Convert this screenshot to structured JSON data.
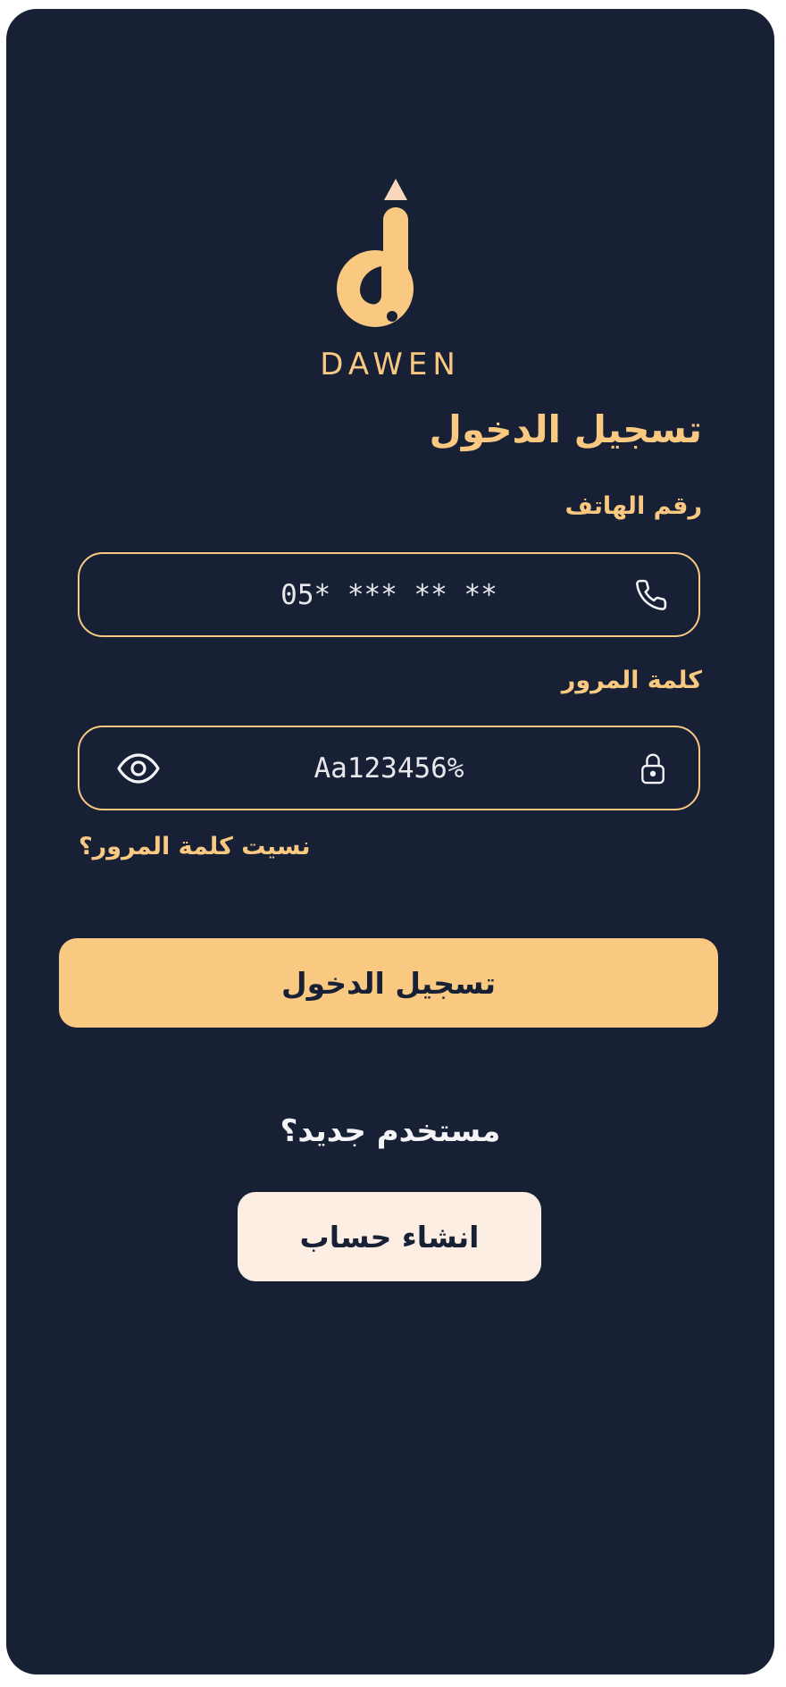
{
  "brand": {
    "name": "DAWEN",
    "logo_icon": "pen-letter-d-logo"
  },
  "login": {
    "title": "تسجيل الدخول",
    "phone_label": "رقم الهاتف",
    "phone_value": "05* *** ** **",
    "phone_icon": "phone-icon",
    "password_label": "كلمة المرور",
    "password_value": "Aa123456%",
    "password_icon": "lock-icon",
    "visibility_icon": "eye-icon",
    "forgot_password": "نسيت كلمة المرور؟",
    "submit_label": "تسجيل الدخول"
  },
  "signup": {
    "prompt": "مستخدم جديد؟",
    "create_account_label": "انشاء حساب"
  },
  "colors": {
    "background": "#172035",
    "accent": "#F9C982",
    "secondary_button": "#FCEEE3",
    "text_light": "#F4F4F6",
    "page_outer": "#FFFFFF"
  }
}
